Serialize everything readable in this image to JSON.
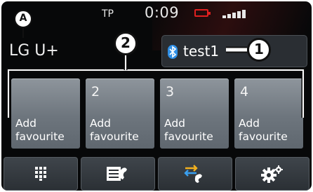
{
  "status": {
    "carrier_code": "TP",
    "time": "0:09"
  },
  "operator": "LG U+",
  "phone": {
    "name": "test1"
  },
  "favourites": [
    {
      "number": "",
      "label": "Add\nfavourite"
    },
    {
      "number": "2",
      "label": "Add\nfavourite"
    },
    {
      "number": "3",
      "label": "Add\nfavourite"
    },
    {
      "number": "4",
      "label": "Add\nfavourite"
    }
  ],
  "bottom_buttons": [
    {
      "icon": "keypad-icon"
    },
    {
      "icon": "contacts-icon"
    },
    {
      "icon": "call-list-icon"
    },
    {
      "icon": "settings-icon"
    }
  ],
  "callouts": {
    "a": "A",
    "one": "1",
    "two": "2"
  },
  "colors": {
    "battery": "#e02020",
    "bluetooth": "#2f8fe6",
    "tile": "#7a8188",
    "screen": "#070809"
  }
}
